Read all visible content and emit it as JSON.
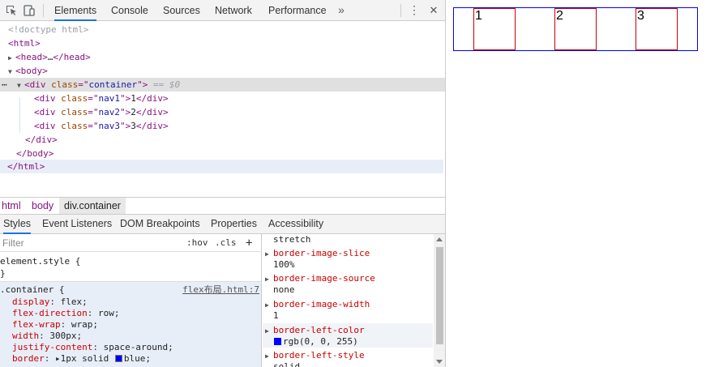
{
  "toolbar": {
    "tabs": [
      "Elements",
      "Console",
      "Sources",
      "Network",
      "Performance"
    ],
    "more": "»",
    "menu": "⋮",
    "close": "✕"
  },
  "dom": {
    "doctype": "<!doctype html>",
    "html_open": "<html>",
    "head_open": "<head>",
    "head_ellipsis": "…",
    "head_close": "</head>",
    "body_open": "<body>",
    "container": {
      "tag": "div",
      "attr": "class",
      "value": "container",
      "suffix": " == $0",
      "dots": "⋯"
    },
    "children": [
      {
        "tag": "div",
        "attr": "class",
        "value": "nav1",
        "text": "1"
      },
      {
        "tag": "div",
        "attr": "class",
        "value": "nav2",
        "text": "2"
      },
      {
        "tag": "div",
        "attr": "class",
        "value": "nav3",
        "text": "3"
      }
    ],
    "div_close": "</div>",
    "body_close": "</body>",
    "html_close": "</html>"
  },
  "breadcrumb": [
    "html",
    "body",
    "div.container"
  ],
  "subtabs": [
    "Styles",
    "Event Listeners",
    "DOM Breakpoints",
    "Properties",
    "Accessibility"
  ],
  "styles": {
    "filter_placeholder": "Filter",
    "hov": ":hov",
    "cls": ".cls",
    "add": "+",
    "element_style": "element.style {",
    "close_brace": "}",
    "rule": {
      "selector": ".container {",
      "source": "flex布局.html:7",
      "declarations": [
        {
          "name": "display",
          "value": "flex;"
        },
        {
          "name": "flex-direction",
          "value": "row;"
        },
        {
          "name": "flex-wrap",
          "value": "wrap;"
        },
        {
          "name": "width",
          "value": "300px;"
        },
        {
          "name": "justify-content",
          "value": "space-around;"
        },
        {
          "name": "border",
          "value_pre": "▸1px solid ",
          "value_post": "blue;",
          "swatch": "#0000ff"
        }
      ]
    }
  },
  "computed": {
    "top_value": "stretch",
    "props": [
      {
        "name": "border-image-slice",
        "value": "100%"
      },
      {
        "name": "border-image-source",
        "value": "none"
      },
      {
        "name": "border-image-width",
        "value": "1"
      },
      {
        "name": "border-left-color",
        "value": "rgb(0, 0, 255)",
        "swatch": "#0000ff"
      },
      {
        "name": "border-left-style",
        "value": "solid"
      }
    ]
  },
  "page": {
    "items": [
      "1",
      "2",
      "3"
    ]
  }
}
